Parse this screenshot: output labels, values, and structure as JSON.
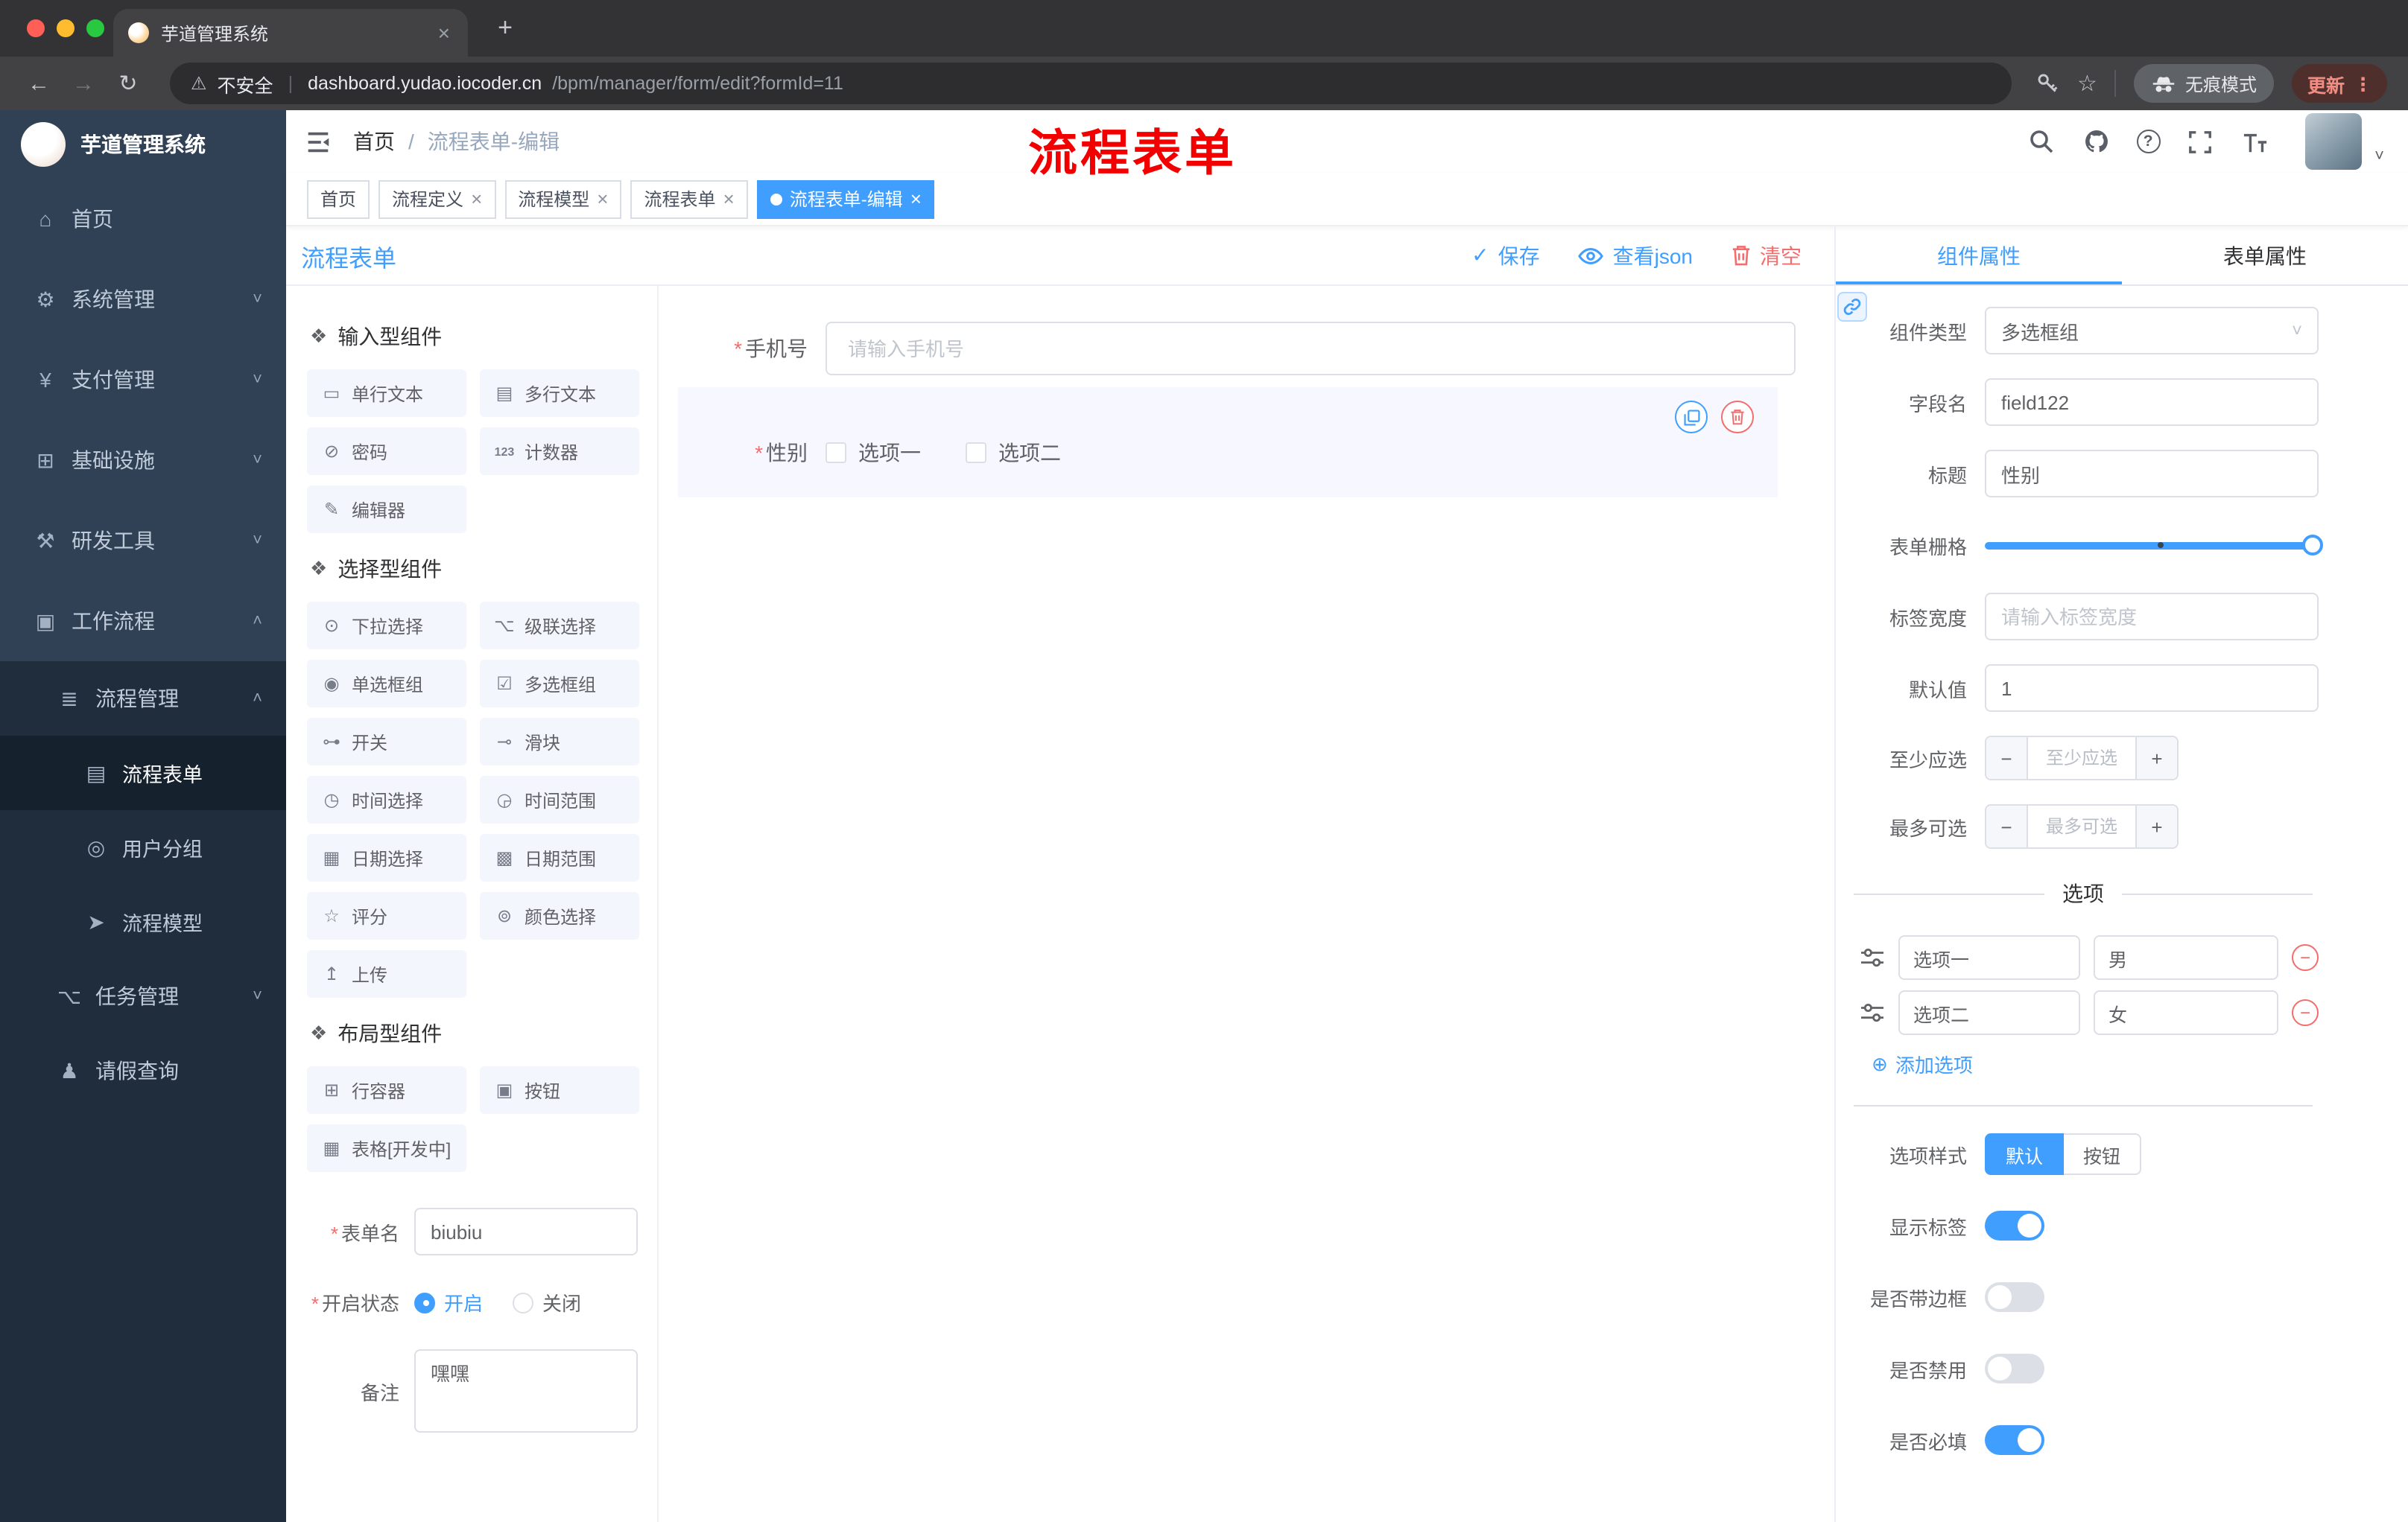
{
  "colors": {
    "primary": "#409EFF",
    "danger": "#F56C6C",
    "annotation": "#F20000"
  },
  "browser": {
    "tab_title": "芋道管理系统",
    "security": "不安全",
    "host": "dashboard.yudao.iocoder.cn",
    "path": "/bpm/manager/form/edit?formId=11",
    "incognito": "无痕模式",
    "update": "更新"
  },
  "icons": {
    "back": "←",
    "forward": "→",
    "reload": "↻",
    "star": "☆",
    "dots": "⋮",
    "warning": "⚠",
    "question": "?",
    "check": "✓",
    "close": "×",
    "plus": "+",
    "minus": "−",
    "asterisk": "*",
    "caret_down": "˅",
    "caret_up": "˄",
    "add_circle": "⊕",
    "menu": {
      "home": "⌂",
      "system": "⚙",
      "payment": "¥",
      "infra": "⊞",
      "devtools": "⚒",
      "workflow": "▣",
      "process_mgmt": "≣",
      "process_form": "▤",
      "user_group": "◎",
      "process_model": "➤",
      "task_mgmt": "⌥",
      "leave_query": "♟"
    },
    "comp": {
      "group": "❖",
      "single_text": "▭",
      "multi_text": "▤",
      "password": "⊘",
      "counter": "123",
      "editor": "✎",
      "select": "⊙",
      "cascader": "⌥",
      "radio": "◉",
      "checkbox": "☑",
      "switch": "⊶",
      "slider": "⊸",
      "time": "◷",
      "time_range": "◶",
      "date": "▦",
      "date_range": "▩",
      "rate": "☆",
      "color": "⊚",
      "upload": "↥",
      "row": "⊞",
      "button": "▣",
      "table": "▦"
    }
  },
  "sidebar": {
    "logo": "芋道管理系统",
    "home": "首页",
    "system": "系统管理",
    "payment": "支付管理",
    "infra": "基础设施",
    "devtools": "研发工具",
    "workflow": "工作流程",
    "process_mgmt": "流程管理",
    "process_form": "流程表单",
    "user_group": "用户分组",
    "process_model": "流程模型",
    "task_mgmt": "任务管理",
    "leave_query": "请假查询"
  },
  "header": {
    "breadcrumb_home": "首页",
    "breadcrumb_sep": "/",
    "breadcrumb_current": "流程表单-编辑",
    "annotation": "流程表单"
  },
  "tags": {
    "home": "首页",
    "def": "流程定义",
    "model": "流程模型",
    "form": "流程表单",
    "edit": "流程表单-编辑"
  },
  "designer": {
    "title": "流程表单",
    "save": "保存",
    "view_json": "查看json",
    "clear": "清空",
    "groups": {
      "input": "输入型组件",
      "select": "选择型组件",
      "layout": "布局型组件"
    },
    "comp": {
      "single_text": "单行文本",
      "multi_text": "多行文本",
      "password": "密码",
      "counter": "计数器",
      "editor": "编辑器",
      "select": "下拉选择",
      "cascader": "级联选择",
      "radio": "单选框组",
      "checkbox": "多选框组",
      "switch": "开关",
      "slider": "滑块",
      "time": "时间选择",
      "time_range": "时间范围",
      "date": "日期选择",
      "date_range": "日期范围",
      "rate": "评分",
      "color": "颜色选择",
      "upload": "上传",
      "row": "行容器",
      "button": "按钮",
      "table": "表格[开发中]"
    },
    "meta": {
      "name_label": "表单名",
      "name_value": "biubiu",
      "status_label": "开启状态",
      "status_on": "开启",
      "status_off": "关闭",
      "remark_label": "备注",
      "remark_value": "嘿嘿"
    },
    "canvas": {
      "phone_label": "手机号",
      "phone_placeholder": "请输入手机号",
      "gender_label": "性别",
      "opt1": "选项一",
      "opt2": "选项二"
    }
  },
  "props": {
    "tab_component": "组件属性",
    "tab_form": "表单属性",
    "type_label": "组件类型",
    "type_value": "多选框组",
    "field_label": "字段名",
    "field_value": "field122",
    "title_label": "标题",
    "title_value": "性别",
    "grid_label": "表单栅格",
    "label_width_label": "标签宽度",
    "label_width_placeholder": "请输入标签宽度",
    "default_label": "默认值",
    "default_value": "1",
    "min_label": "至少应选",
    "min_placeholder": "至少应选",
    "max_label": "最多可选",
    "max_placeholder": "最多可选",
    "options_title": "选项",
    "opt1_label": "选项一",
    "opt1_value": "男",
    "opt2_label": "选项二",
    "opt2_value": "女",
    "add_option": "添加选项",
    "style_label": "选项样式",
    "style_default": "默认",
    "style_button": "按钮",
    "show_label": "显示标签",
    "border_label": "是否带边框",
    "disabled_label": "是否禁用",
    "required_label": "是否必填"
  }
}
